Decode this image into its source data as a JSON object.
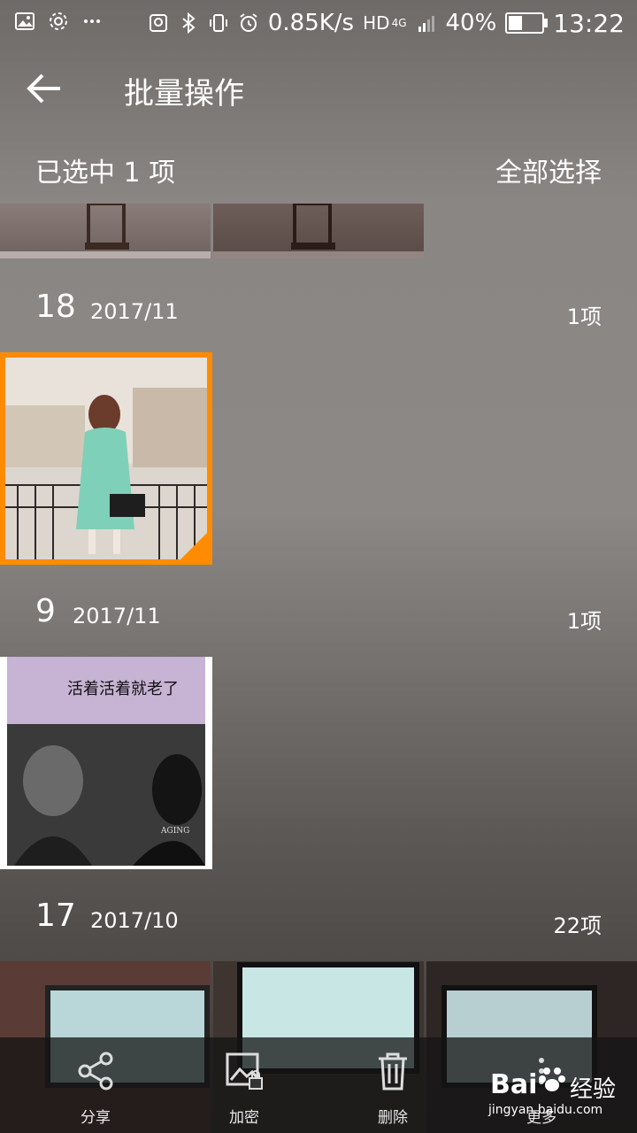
{
  "status": {
    "speed": "0.85K/s",
    "hd": "HD",
    "net": "4G",
    "battery": "40%",
    "battery_level": 0.4,
    "time": "13:22"
  },
  "header": {
    "title": "批量操作"
  },
  "selection": {
    "count_label": "已选中 1 项",
    "select_all": "全部选择"
  },
  "groups": [
    {
      "day": "18",
      "date": "2017/11",
      "count": "1项"
    },
    {
      "day": "9",
      "date": "2017/11",
      "count": "1项"
    },
    {
      "day": "17",
      "date": "2017/10",
      "count": "22项"
    }
  ],
  "thumbs": {
    "poster_title": "活着活着就老了",
    "poster_caption": "AGING"
  },
  "accent": "#ff8c00",
  "bottom": [
    {
      "label": "分享",
      "icon": "share-icon"
    },
    {
      "label": "加密",
      "icon": "image-lock-icon"
    },
    {
      "label": "删除",
      "icon": "trash-icon"
    },
    {
      "label": "更多",
      "icon": "more-icon"
    }
  ],
  "watermark": {
    "brand": "Bai",
    "brand2": "经验",
    "site": "jingyan.baidu.com"
  }
}
